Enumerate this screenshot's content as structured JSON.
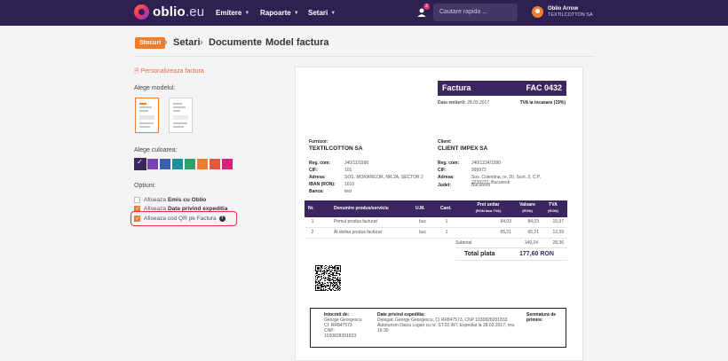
{
  "navbar": {
    "logo_main": "oblio",
    "logo_suffix": ".eu",
    "menu": [
      {
        "label": "Emitere"
      },
      {
        "label": "Rapoarte"
      },
      {
        "label": "Setari"
      }
    ],
    "notification_count": "2",
    "search_placeholder": "Cautare rapida ...",
    "user_name": "Oblio Arrow",
    "user_company": "TEXTILCOTTON SA"
  },
  "breadcrumb": {
    "badge": "Stocuri",
    "items": [
      "Setari",
      "Documente",
      "Model factura"
    ],
    "separator": "›"
  },
  "left_panel": {
    "personalize_link": "Personalizeaza factura",
    "model_label": "Alege modelul:",
    "color_label": "Alege culoarea:",
    "options_label": "Optiuni:",
    "colors": [
      "#3b2660",
      "#7b3fb8",
      "#3a5fb0",
      "#1f8f9e",
      "#2aa56a",
      "#f07c2d",
      "#e4573a",
      "#d8207a"
    ],
    "options": [
      {
        "prefix": "Afiseaza",
        "bold": "Emis cu Oblio",
        "checked": false
      },
      {
        "prefix": "Afiseaza",
        "bold": "Data privind expeditia",
        "checked": true
      },
      {
        "prefix": "Afiseaza cod QR pe Factura",
        "bold": "",
        "checked": true
      }
    ]
  },
  "invoice": {
    "title": "Factura",
    "number": "FAC 0432",
    "issue_label": "Data emiterii:",
    "issue_date": "28.03.2017",
    "vat_label": "TVA la incasare (19%)",
    "supplier_label": "Furnizor:",
    "supplier_name": "TEXTILCOTTON SA",
    "supplier_fields": [
      {
        "k": "Reg. com:",
        "v": "J40/11/1990"
      },
      {
        "k": "CIF:",
        "v": "101"
      },
      {
        "k": "Adresa:",
        "v": "SOS. MORARILOR, NR.2A, SECTOR 2"
      },
      {
        "k": "IBAN (RON):",
        "v": "1010"
      },
      {
        "k": "Banca:",
        "v": "test"
      }
    ],
    "client_label": "Client:",
    "client_name": "CLIENT IMPEX SA",
    "client_fields": [
      {
        "k": "Reg. com:",
        "v": "J40/1234/1990"
      },
      {
        "k": "CIF:",
        "v": "999972"
      },
      {
        "k": "Adresa:",
        "v": "Sos. Colentina, nr. 20, Scot. 2, C.P. 2239231, Bucuresti"
      },
      {
        "k": "Judet:",
        "v": "Bucuresti"
      }
    ],
    "columns": [
      "Nr.",
      "Denumire produs/serviciu",
      "U.M.",
      "Cant.",
      "Pret unitar",
      "(RON fara TVA)",
      "Valoare",
      "(RON)",
      "TVA",
      "(RON)"
    ],
    "rows": [
      {
        "nr": "1",
        "name": "Primul produs facturat",
        "um": "buc",
        "qty": "1",
        "price": "84,03",
        "value": "84,03",
        "vat": "15,97"
      },
      {
        "nr": "2",
        "name": "Al doilea produs facturat",
        "um": "buc",
        "qty": "1",
        "price": "65,21",
        "value": "65,21",
        "vat": "12,39"
      }
    ],
    "subtotal_label": "Subtotal",
    "subtotal_value": "149,24",
    "subtotal_vat": "28,36",
    "total_label": "Total plata",
    "total_value": "177,60 RON",
    "footer": {
      "issued_label": "Intocmit de:",
      "issued_lines": [
        "George Georgescu",
        "CI: RR847573",
        "CNP:",
        "1030828201833"
      ],
      "shipping_label": "Date privind expeditia:",
      "shipping_lines": [
        "Delegat: George Georgescu, CI RR847573, CNP 1030828201833",
        "Autoturism Dacia Logan cu nr. ST.02.INT. Expediat la 28.03.2017, ora",
        "16:30"
      ],
      "signature_label": "Semnatura de",
      "signature_label2": "primire:"
    }
  }
}
